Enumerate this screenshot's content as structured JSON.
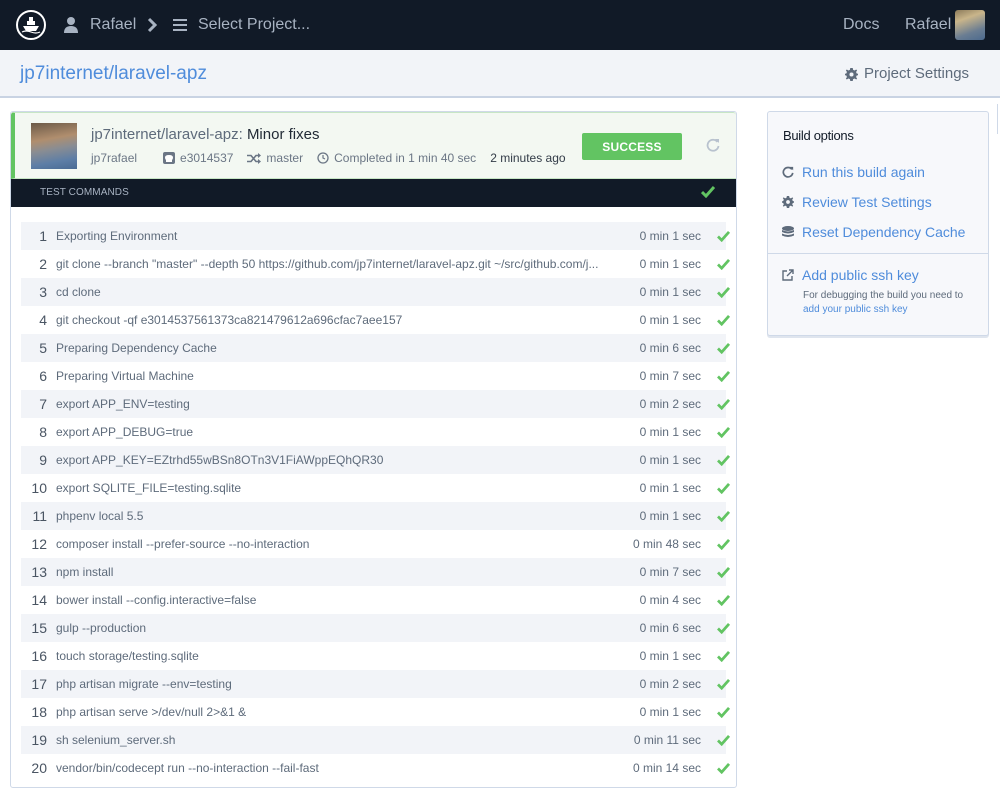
{
  "topnav": {
    "user": "Rafael",
    "select_project": "Select Project...",
    "docs": "Docs",
    "account_name": "Rafael"
  },
  "subheader": {
    "project": "jp7internet/laravel-apz",
    "settings_label": "Project Settings"
  },
  "build": {
    "repo": "jp7internet/laravel-apz:",
    "message": "Minor fixes",
    "author": "jp7rafael",
    "commit": "e3014537",
    "branch": "master",
    "duration": "Completed in 1 min 40 sec",
    "ago": "2 minutes ago",
    "status": "SUCCESS",
    "status_color": "#62c462"
  },
  "commands": {
    "header": "TEST COMMANDS",
    "items": [
      {
        "num": "1",
        "text": "Exporting Environment",
        "time": "0 min 1 sec",
        "status": "success"
      },
      {
        "num": "2",
        "text": "git clone --branch \"master\" --depth 50 https://github.com/jp7internet/laravel-apz.git ~/src/github.com/j...",
        "time": "0 min 1 sec",
        "status": "success"
      },
      {
        "num": "3",
        "text": "cd clone",
        "time": "0 min 1 sec",
        "status": "success"
      },
      {
        "num": "4",
        "text": "git checkout -qf e3014537561373ca821479612a696cfac7aee157",
        "time": "0 min 1 sec",
        "status": "success"
      },
      {
        "num": "5",
        "text": "Preparing Dependency Cache",
        "time": "0 min 6 sec",
        "status": "success"
      },
      {
        "num": "6",
        "text": "Preparing Virtual Machine",
        "time": "0 min 7 sec",
        "status": "success"
      },
      {
        "num": "7",
        "text": "export APP_ENV=testing",
        "time": "0 min 2 sec",
        "status": "success"
      },
      {
        "num": "8",
        "text": "export APP_DEBUG=true",
        "time": "0 min 1 sec",
        "status": "success"
      },
      {
        "num": "9",
        "text": "export APP_KEY=EZtrhd55wBSn8OTn3V1FiAWppEQhQR30",
        "time": "0 min 1 sec",
        "status": "success"
      },
      {
        "num": "10",
        "text": "export SQLITE_FILE=testing.sqlite",
        "time": "0 min 1 sec",
        "status": "success"
      },
      {
        "num": "11",
        "text": "phpenv local 5.5",
        "time": "0 min 1 sec",
        "status": "success"
      },
      {
        "num": "12",
        "text": "composer install --prefer-source --no-interaction",
        "time": "0 min 48 sec",
        "status": "success"
      },
      {
        "num": "13",
        "text": "npm install",
        "time": "0 min 7 sec",
        "status": "success"
      },
      {
        "num": "14",
        "text": "bower install --config.interactive=false",
        "time": "0 min 4 sec",
        "status": "success"
      },
      {
        "num": "15",
        "text": "gulp --production",
        "time": "0 min 6 sec",
        "status": "success"
      },
      {
        "num": "16",
        "text": "touch storage/testing.sqlite",
        "time": "0 min 1 sec",
        "status": "success"
      },
      {
        "num": "17",
        "text": "php artisan migrate --env=testing",
        "time": "0 min 2 sec",
        "status": "success"
      },
      {
        "num": "18",
        "text": "php artisan serve >/dev/null 2>&1 &",
        "time": "0 min 1 sec",
        "status": "success"
      },
      {
        "num": "19",
        "text": "sh selenium_server.sh",
        "time": "0 min 11 sec",
        "status": "success"
      },
      {
        "num": "20",
        "text": "vendor/bin/codecept run --no-interaction --fail-fast",
        "time": "0 min 14 sec",
        "status": "success"
      }
    ]
  },
  "build_options": {
    "title": "Build options",
    "run_again": "Run this build again",
    "review_settings": "Review Test Settings",
    "reset_cache": "Reset Dependency Cache",
    "add_ssh": "Add public ssh key",
    "ssh_note": "For debugging the build you need to",
    "ssh_link": "add your public ssh key"
  },
  "colors": {
    "nav_bg": "#111a27",
    "link": "#4f8cdb",
    "success": "#62c462"
  }
}
